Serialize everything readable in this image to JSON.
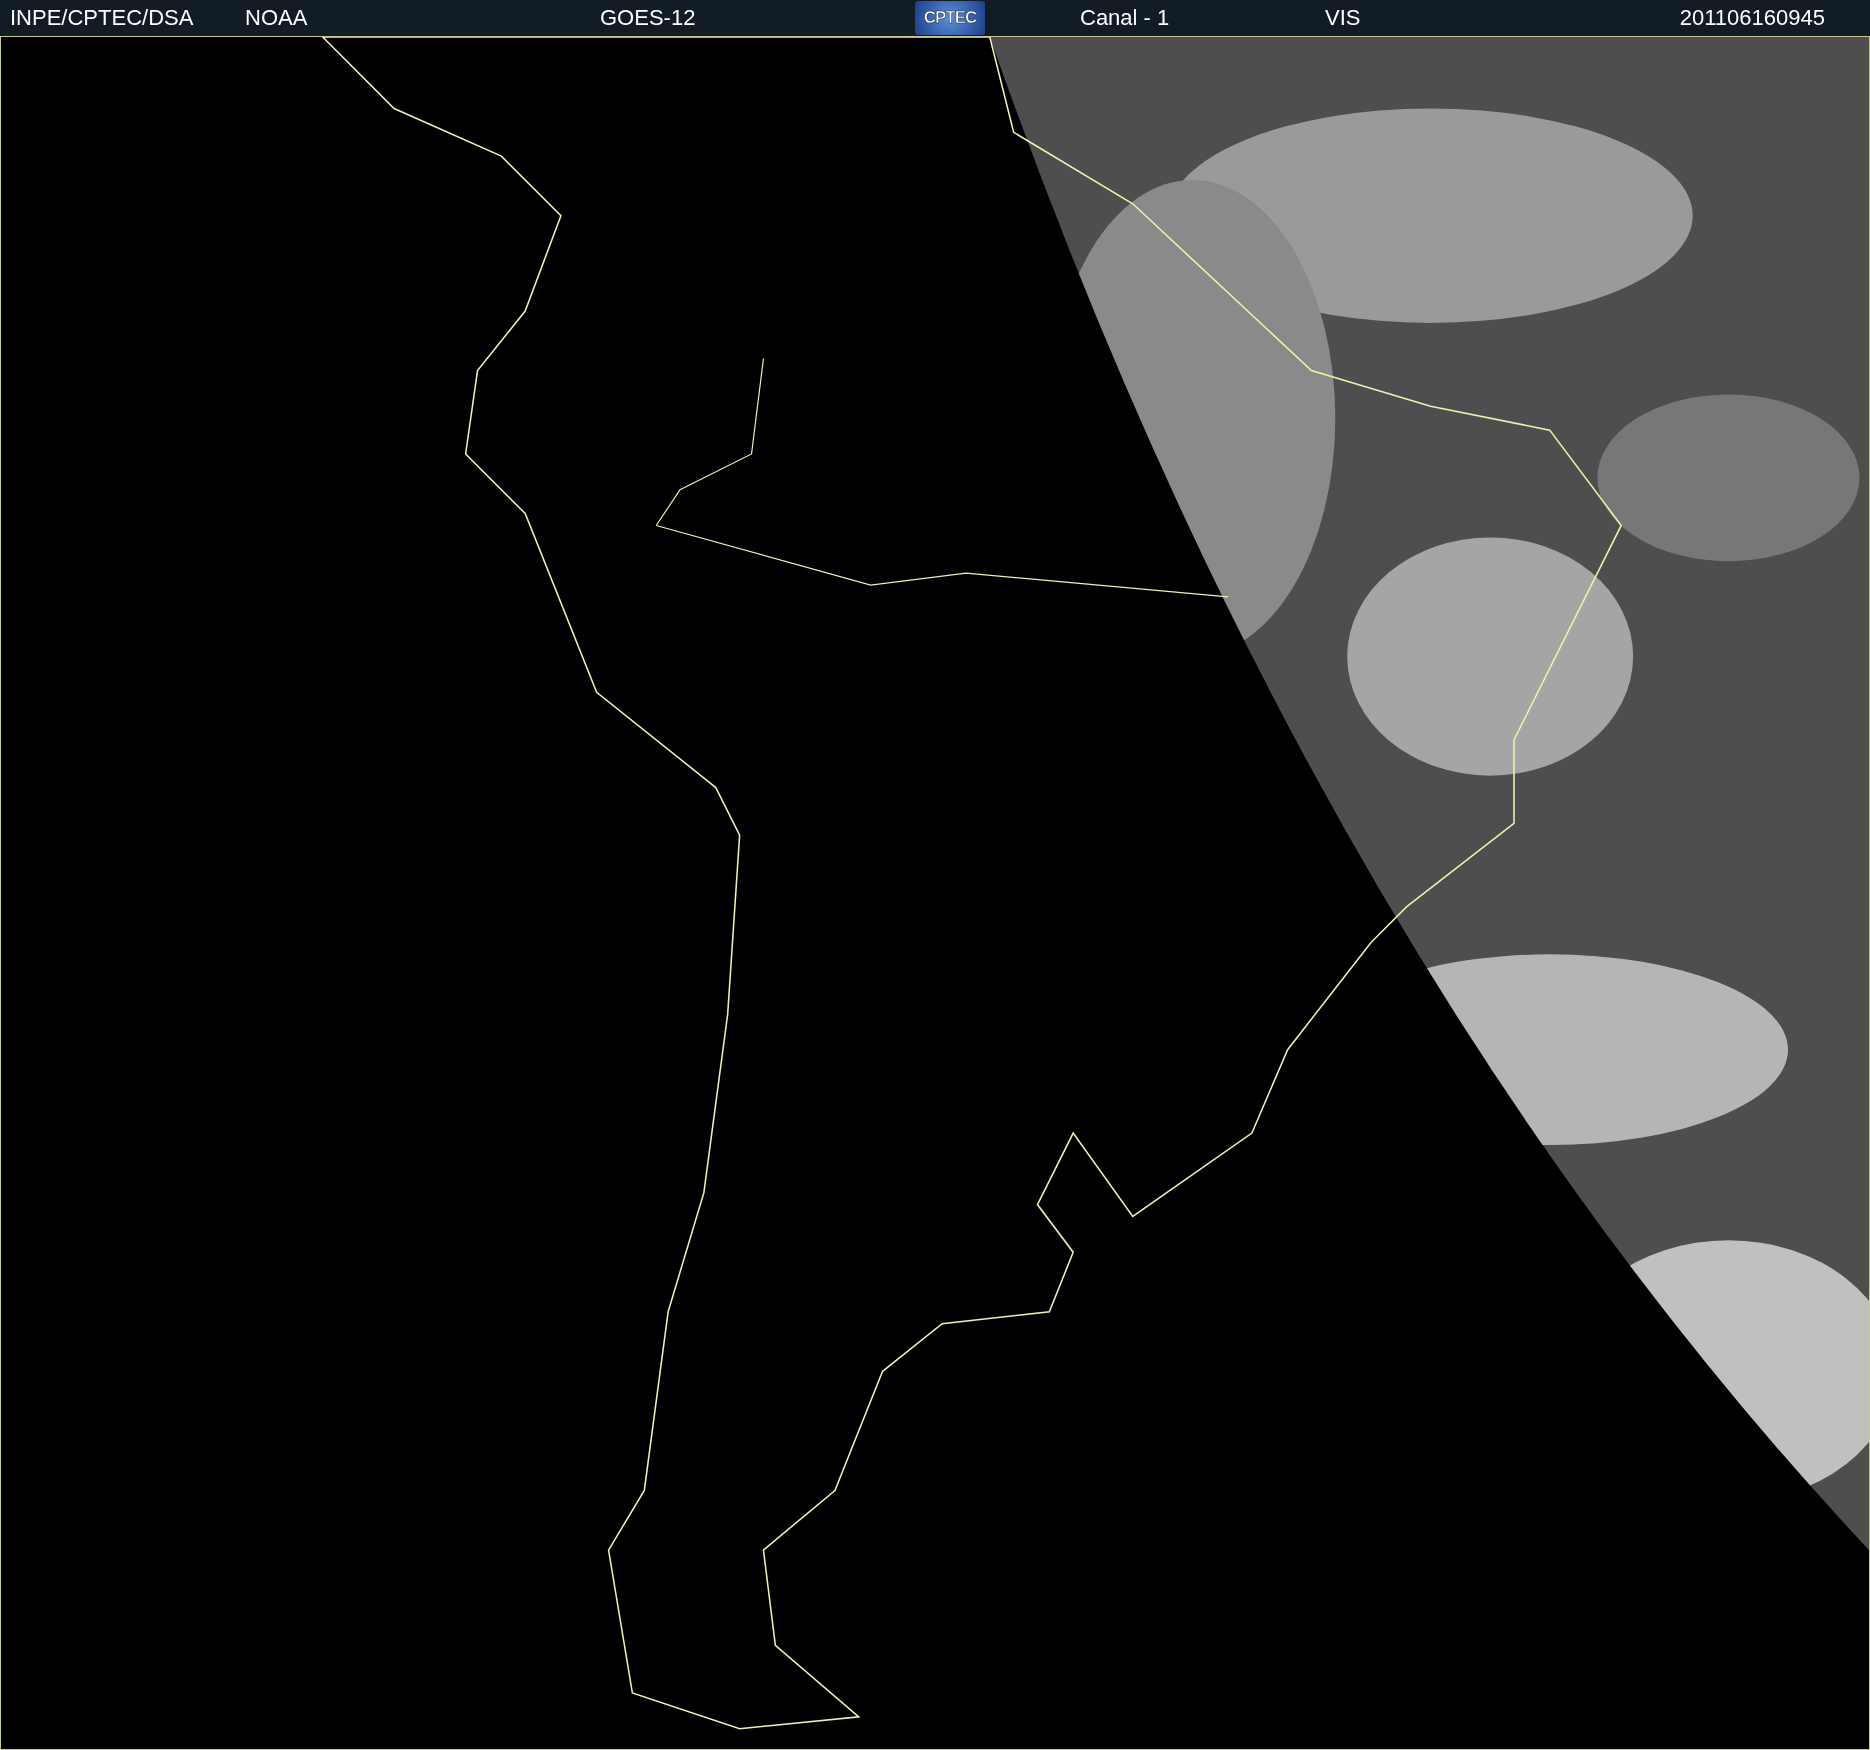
{
  "header": {
    "source": "INPE/CPTEC/DSA",
    "agency": "NOAA",
    "satellite": "GOES-12",
    "logo": "CPTEC",
    "channel": "Canal - 1",
    "band": "VIS",
    "timestamp": "201106160945"
  }
}
